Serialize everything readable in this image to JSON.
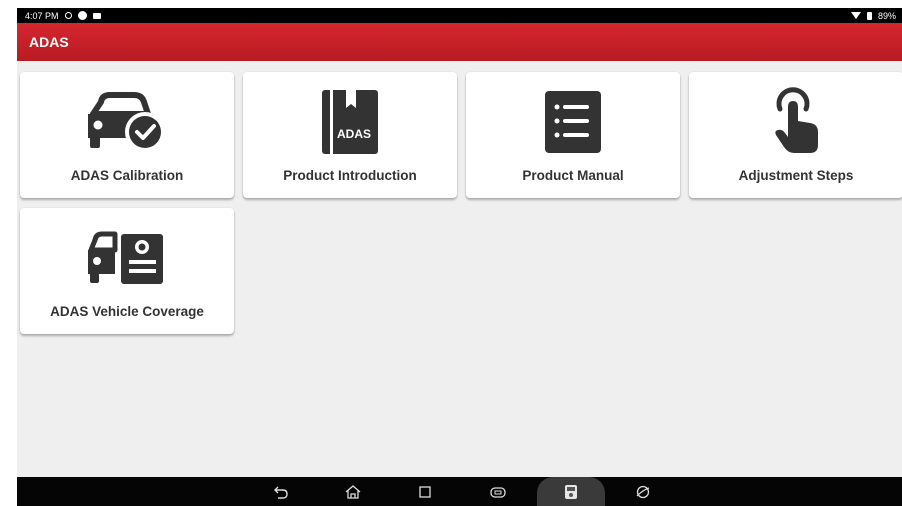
{
  "status_bar": {
    "time": "4:07 PM",
    "battery": "89%",
    "icons": [
      "location-icon",
      "message-icon",
      "cast-icon",
      "wifi-icon",
      "battery-icon"
    ]
  },
  "app_bar": {
    "title": "ADAS"
  },
  "tiles": [
    {
      "label": "ADAS Calibration",
      "icon": "car-check-icon"
    },
    {
      "label": "Product Introduction",
      "icon": "adas-book-icon",
      "icon_text": "ADAS"
    },
    {
      "label": "Product Manual",
      "icon": "list-document-icon"
    },
    {
      "label": "Adjustment Steps",
      "icon": "finger-tap-icon"
    },
    {
      "label": "ADAS Vehicle Coverage",
      "icon": "car-id-card-icon"
    }
  ],
  "nav_bar": {
    "buttons": [
      "back-icon",
      "home-icon",
      "recents-icon",
      "vci-icon",
      "diagnostic-icon",
      "browser-icon"
    ]
  },
  "colors": {
    "app_bar": "#c8202a",
    "icon": "#333333",
    "background": "#efefef"
  }
}
